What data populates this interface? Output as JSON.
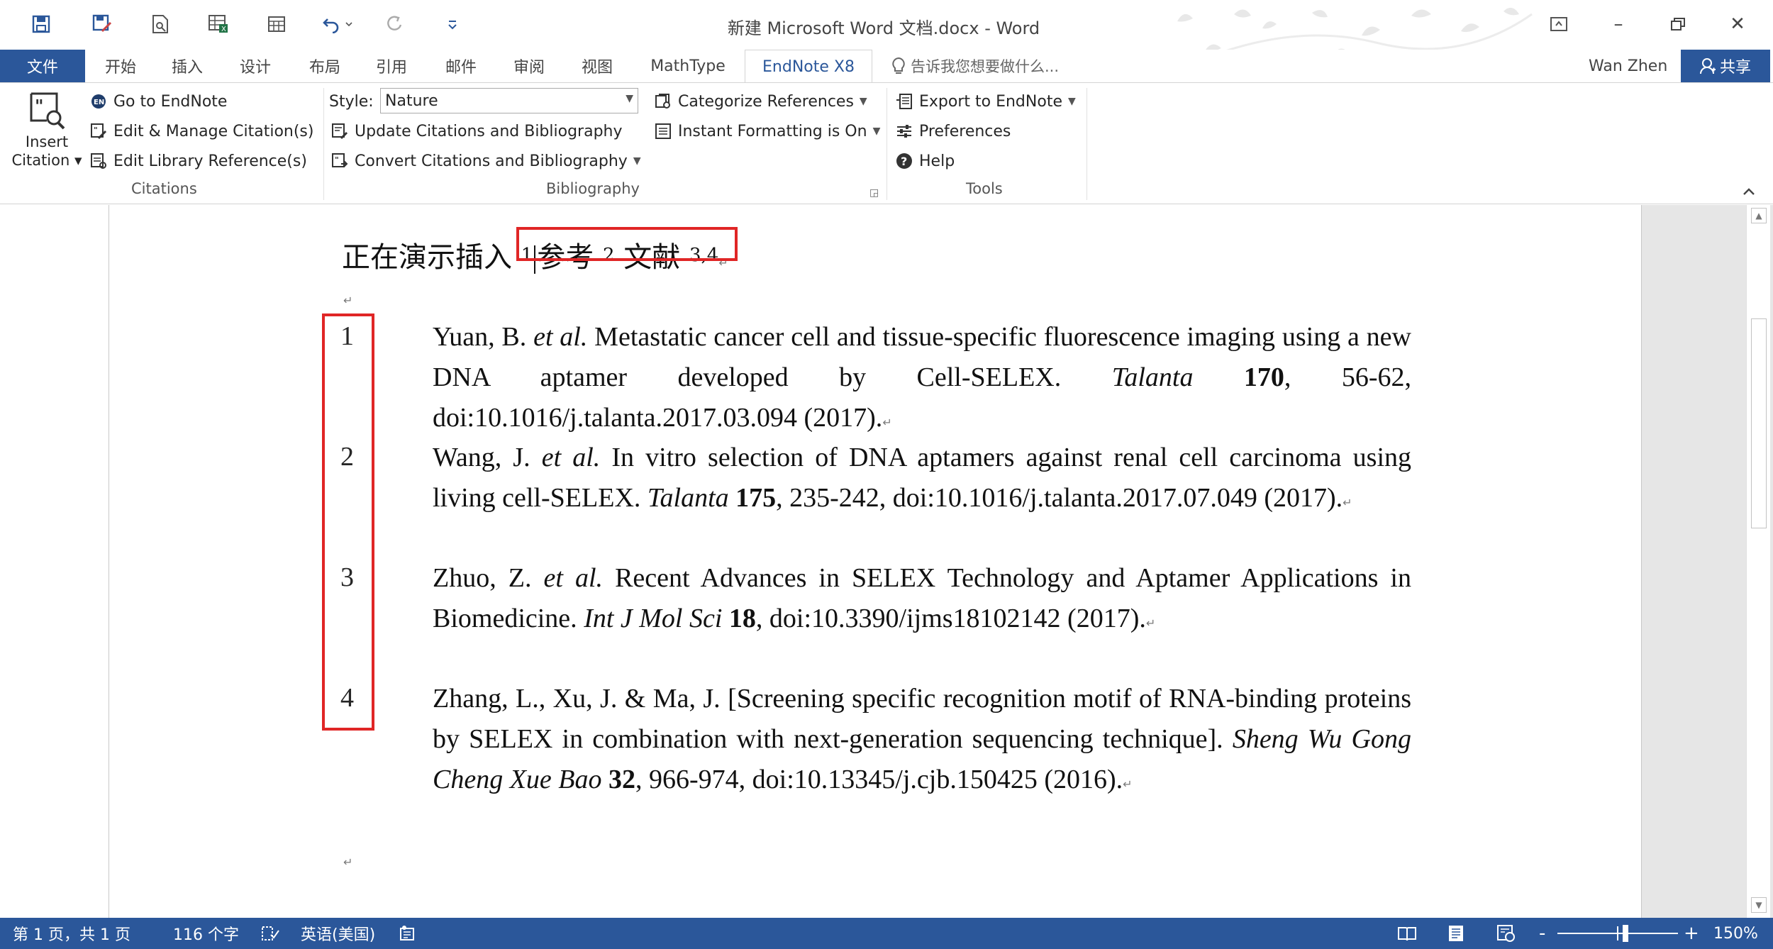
{
  "window": {
    "title": "新建 Microsoft Word 文档.docx - Word",
    "controls": {
      "restore_ribbon": "ribbon-display-options",
      "minimize": "–",
      "maximize": "restore",
      "close": "✕"
    }
  },
  "quick_access": [
    "save-icon",
    "save-as-icon",
    "print-preview-icon",
    "excel-icon",
    "table-icon",
    "undo-icon",
    "redo-icon",
    "customize-icon"
  ],
  "tabs": [
    {
      "label": "文件"
    },
    {
      "label": "开始"
    },
    {
      "label": "插入"
    },
    {
      "label": "设计"
    },
    {
      "label": "布局"
    },
    {
      "label": "引用"
    },
    {
      "label": "邮件"
    },
    {
      "label": "审阅"
    },
    {
      "label": "视图"
    },
    {
      "label": "MathType"
    },
    {
      "label": "EndNote X8"
    }
  ],
  "tell_me": "告诉我您想要做什么...",
  "user": "Wan Zhen",
  "share": "共享",
  "ribbon": {
    "citations": {
      "insert_label_1": "Insert",
      "insert_label_2": "Citation",
      "go_to": "Go to EndNote",
      "edit_manage": "Edit & Manage Citation(s)",
      "edit_library": "Edit Library Reference(s)",
      "group": "Citations"
    },
    "bibliography": {
      "style_label": "Style:",
      "style_value": "Nature",
      "update": "Update Citations and Bibliography",
      "convert": "Convert Citations and Bibliography",
      "categorize": "Categorize References",
      "instant": "Instant Formatting is On",
      "group": "Bibliography"
    },
    "tools": {
      "export": "Export to EndNote",
      "preferences": "Preferences",
      "help": "Help",
      "group": "Tools"
    }
  },
  "document": {
    "line1_text": "正在演示插入",
    "line1_cites": [
      "1",
      "参考",
      "2",
      "文献",
      "3,4"
    ],
    "references": [
      {
        "num": "1"
      },
      {
        "num": "2"
      },
      {
        "num": "3"
      },
      {
        "num": "4"
      }
    ],
    "ref1": {
      "a": "Yuan, B. ",
      "b": "et al.",
      "c": " Metastatic cancer cell and tissue-specific fluorescence imaging using a new DNA aptamer developed by Cell-SELEX. ",
      "d": "Talanta",
      "e": "170",
      "f": ", 56-62, doi:10.1016/j.talanta.2017.03.094 (2017)."
    },
    "ref2": {
      "a": "Wang, J. ",
      "b": "et al.",
      "c": " In vitro selection of DNA aptamers against renal cell carcinoma using living cell-SELEX. ",
      "d": "Talanta",
      "e": "175",
      "f": ", 235-242, doi:10.1016/j.talanta.2017.07.049 (2017)."
    },
    "ref3": {
      "a": "Zhuo, Z. ",
      "b": "et al.",
      "c": " Recent Advances in SELEX Technology and Aptamer Applications in Biomedicine. ",
      "d": "Int J Mol Sci",
      "e": "18",
      "f": ", doi:10.3390/ijms18102142 (2017)."
    },
    "ref4": {
      "a": "Zhang, L., Xu, J. & Ma, J. [Screening specific recognition motif of RNA-binding proteins by SELEX in combination with next-generation sequencing technique]. ",
      "d": "Sheng Wu Gong Cheng Xue Bao",
      "e": "32",
      "f": ", 966-974, doi:10.13345/j.cjb.150425 (2016)."
    },
    "para_mark": "↵"
  },
  "status": {
    "page": "第 1 页，共 1 页",
    "words": "116 个字",
    "language": "英语(美国)",
    "zoom": "150%",
    "zoom_minus": "-",
    "zoom_plus": "+"
  },
  "colors": {
    "accent": "#2b579a",
    "highlight": "#e02626"
  }
}
